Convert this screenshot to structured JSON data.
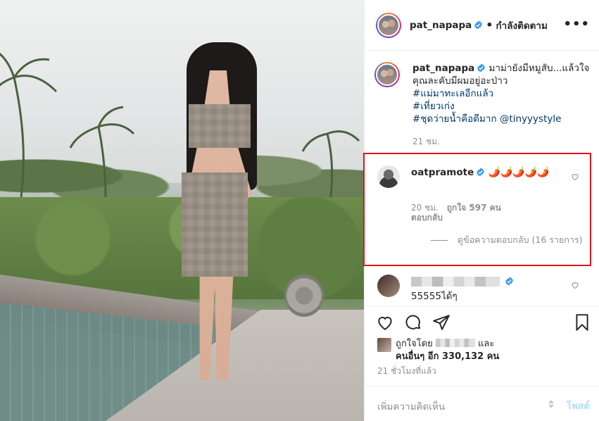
{
  "post": {
    "username": "pat_napapa",
    "follow_status": "กำลังติดตาม",
    "more_label": "•••"
  },
  "caption": {
    "text": "มาม่ายังมีหมูสับ...แล้วใจคุณละคับมีผมอยู่อะป่าว",
    "tags": [
      "#แม่มาทะเลอีกแล้ว",
      "#เที่ยวเก่ง",
      "#ชุดว่ายน้ำคือดีมาก @tinyyystyle"
    ],
    "time": "21 ชม."
  },
  "highlighted_comment": {
    "username": "oatpramote",
    "text": "🌶️🌶️🌶️🌶️🌶️",
    "time": "20 ชม.",
    "likes": "ถูกใจ 597 คน",
    "reply": "ตอบกลับ",
    "view_replies": "ดูข้อความตอบกลับ (16 รายการ)",
    "highlight_color": "#e0151b"
  },
  "second_comment": {
    "text": "55555ได้ๆ"
  },
  "likes_section": {
    "liked_by": "ถูกใจโดย",
    "and": "และ",
    "others": "คนอื่นๆ อีก 330,132 คน",
    "time": "21 ชั่วโมงที่แล้ว"
  },
  "add_comment": {
    "placeholder": "เพิ่มความคิดเห็น",
    "post_label": "โพสต์"
  },
  "colors": {
    "link": "#00376b",
    "verified": "#3897f0",
    "muted": "#8e8e8e",
    "post_disabled": "#b2dffc"
  },
  "icons": [
    "verified-icon",
    "heart-icon",
    "comment-icon",
    "share-icon",
    "bookmark-icon",
    "more-icon",
    "emoji-icon"
  ]
}
